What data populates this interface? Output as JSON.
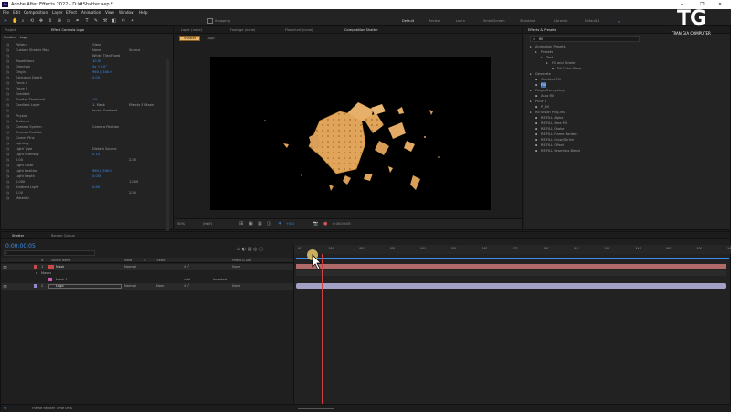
{
  "window": {
    "title": "Adobe After Effects 2022 - D:\\#Shatter.aep *",
    "controls": [
      "─",
      "❐",
      "✕"
    ]
  },
  "menu": [
    "File",
    "Edit",
    "Composition",
    "Layer",
    "Effect",
    "Animation",
    "View",
    "Window",
    "Help"
  ],
  "workspaces": [
    "Default",
    "Review",
    "Learn",
    "Small Screen",
    "Standard",
    "Libraries",
    "Default1"
  ],
  "tools": {
    "snapping": "Snapping",
    "search_placeholder": "Search Help"
  },
  "watermark": {
    "logo": "TG",
    "text": "TRAN GIA COMPUTER"
  },
  "effect_controls": {
    "tabs": [
      "Project",
      "Effect Controls Logo"
    ],
    "header": "Shatter • Logo",
    "rows": [
      {
        "label": "Pattern",
        "value": "Glass"
      },
      {
        "label": "Custom Shatter Map",
        "value": "None",
        "value2": "Source"
      },
      {
        "label": "",
        "value": "White Tiles Fixed"
      },
      {
        "label": "Repetitions",
        "value": "10.00"
      },
      {
        "label": "Direction",
        "value": "0x +0.0°"
      },
      {
        "label": "Origin",
        "value": "960.0,540.0"
      },
      {
        "label": "Extrusion Depth",
        "value": "0.00"
      },
      {
        "label": "Force 1",
        "value": ""
      },
      {
        "label": "Force 2",
        "value": ""
      },
      {
        "label": "Gradient",
        "value": ""
      },
      {
        "label": "Shatter Threshold",
        "value": "1%"
      },
      {
        "label": "Gradient Layer",
        "value": "1. Mask",
        "value2": "Effects & Masks"
      },
      {
        "label": "",
        "value": "Invert Gradient"
      },
      {
        "label": "Physics",
        "value": ""
      },
      {
        "label": "Textures",
        "value": ""
      },
      {
        "label": "Camera System",
        "value": "Camera Position"
      },
      {
        "label": "Camera Position",
        "value": ""
      },
      {
        "label": "Corner Pins",
        "value": ""
      },
      {
        "label": "Lighting",
        "value": ""
      },
      {
        "label": "Light Type",
        "value": "Distant Source"
      },
      {
        "label": "Light Intensity",
        "value": "0.10"
      },
      {
        "label": "0.00",
        "value": "",
        "value2": "2.00"
      },
      {
        "label": "Light Color",
        "value": ""
      },
      {
        "label": "Light Position",
        "value": "960.0,540.0"
      },
      {
        "label": "Light Depth",
        "value": "0.000"
      },
      {
        "label": "0.000",
        "value": "",
        "value2": "1.000"
      },
      {
        "label": "Ambient Light",
        "value": "0.60"
      },
      {
        "label": "0.00",
        "value": "",
        "value2": "2.00"
      },
      {
        "label": "Material",
        "value": ""
      }
    ]
  },
  "center_tabs": {
    "row1": [
      "Layer (none)",
      "Footage (none)",
      "Flowchart (none)",
      "Composition Shatter"
    ],
    "row2": [
      "Shatter",
      "Logo"
    ]
  },
  "viewer_bar": {
    "zoom": "50%",
    "quality": "(Half)",
    "timecode": "+0.0",
    "view": "0:00:00:05"
  },
  "effects_presets": {
    "title": "Effects & Presets",
    "search": "fill",
    "items": [
      {
        "text": "Animation Presets",
        "level": 0
      },
      {
        "text": "Presets",
        "level": 1
      },
      {
        "text": "Text",
        "level": 2
      },
      {
        "text": "Fill and Stroke",
        "level": 3
      },
      {
        "text": "Fill Color Wave",
        "level": 4
      },
      {
        "text": "Generate",
        "level": 0
      },
      {
        "text": "Gradient Fill",
        "level": 1
      },
      {
        "text": "Fill",
        "level": 1
      },
      {
        "text": "Plugin Everything",
        "level": 0
      },
      {
        "text": "Auto Fill",
        "level": 1
      },
      {
        "text": "PSOFT",
        "level": 0
      },
      {
        "text": "P_Fill",
        "level": 1
      },
      {
        "text": "RE:Vision Plug-ins",
        "level": 0
      },
      {
        "text": "RE:FILL Alpha",
        "level": 1
      },
      {
        "text": "RE:FILL Area Fill",
        "level": 1
      },
      {
        "text": "RE:FILL Choke",
        "level": 1
      },
      {
        "text": "RE:FILL Frame Borders",
        "level": 1
      },
      {
        "text": "RE:FILL Grow/Shrink",
        "level": 1
      },
      {
        "text": "RE:FILL Offset",
        "level": 1
      },
      {
        "text": "RE:FILL Seamless Blend",
        "level": 1
      }
    ]
  },
  "timeline": {
    "tabs": [
      "Shatter",
      "Render Queue"
    ],
    "timecode": "0:00:00:05",
    "columns": [
      "#",
      "Source Name",
      "Mode",
      "T",
      "TrkMat",
      "Parent & Link"
    ],
    "layers": [
      {
        "num": "1",
        "name": "Mask",
        "mode": "Normal",
        "parent": "None"
      },
      {
        "num": "",
        "name": "Masks",
        "mode": "",
        "parent": ""
      },
      {
        "num": "",
        "name": "Mask 1",
        "mode": "Add",
        "parent": "Inverted"
      },
      {
        "num": "2",
        "name": "Logo",
        "mode": "Normal",
        "trkmat": "None",
        "parent": "None"
      }
    ],
    "ruler": [
      "0f",
      "01f",
      "02f",
      "03f",
      "04f",
      "05f",
      "06f",
      "07f",
      "08f",
      "09f",
      "10f",
      "11f",
      "12f",
      "13f",
      "14f"
    ],
    "footer": "Frame Render Time  0ms"
  }
}
